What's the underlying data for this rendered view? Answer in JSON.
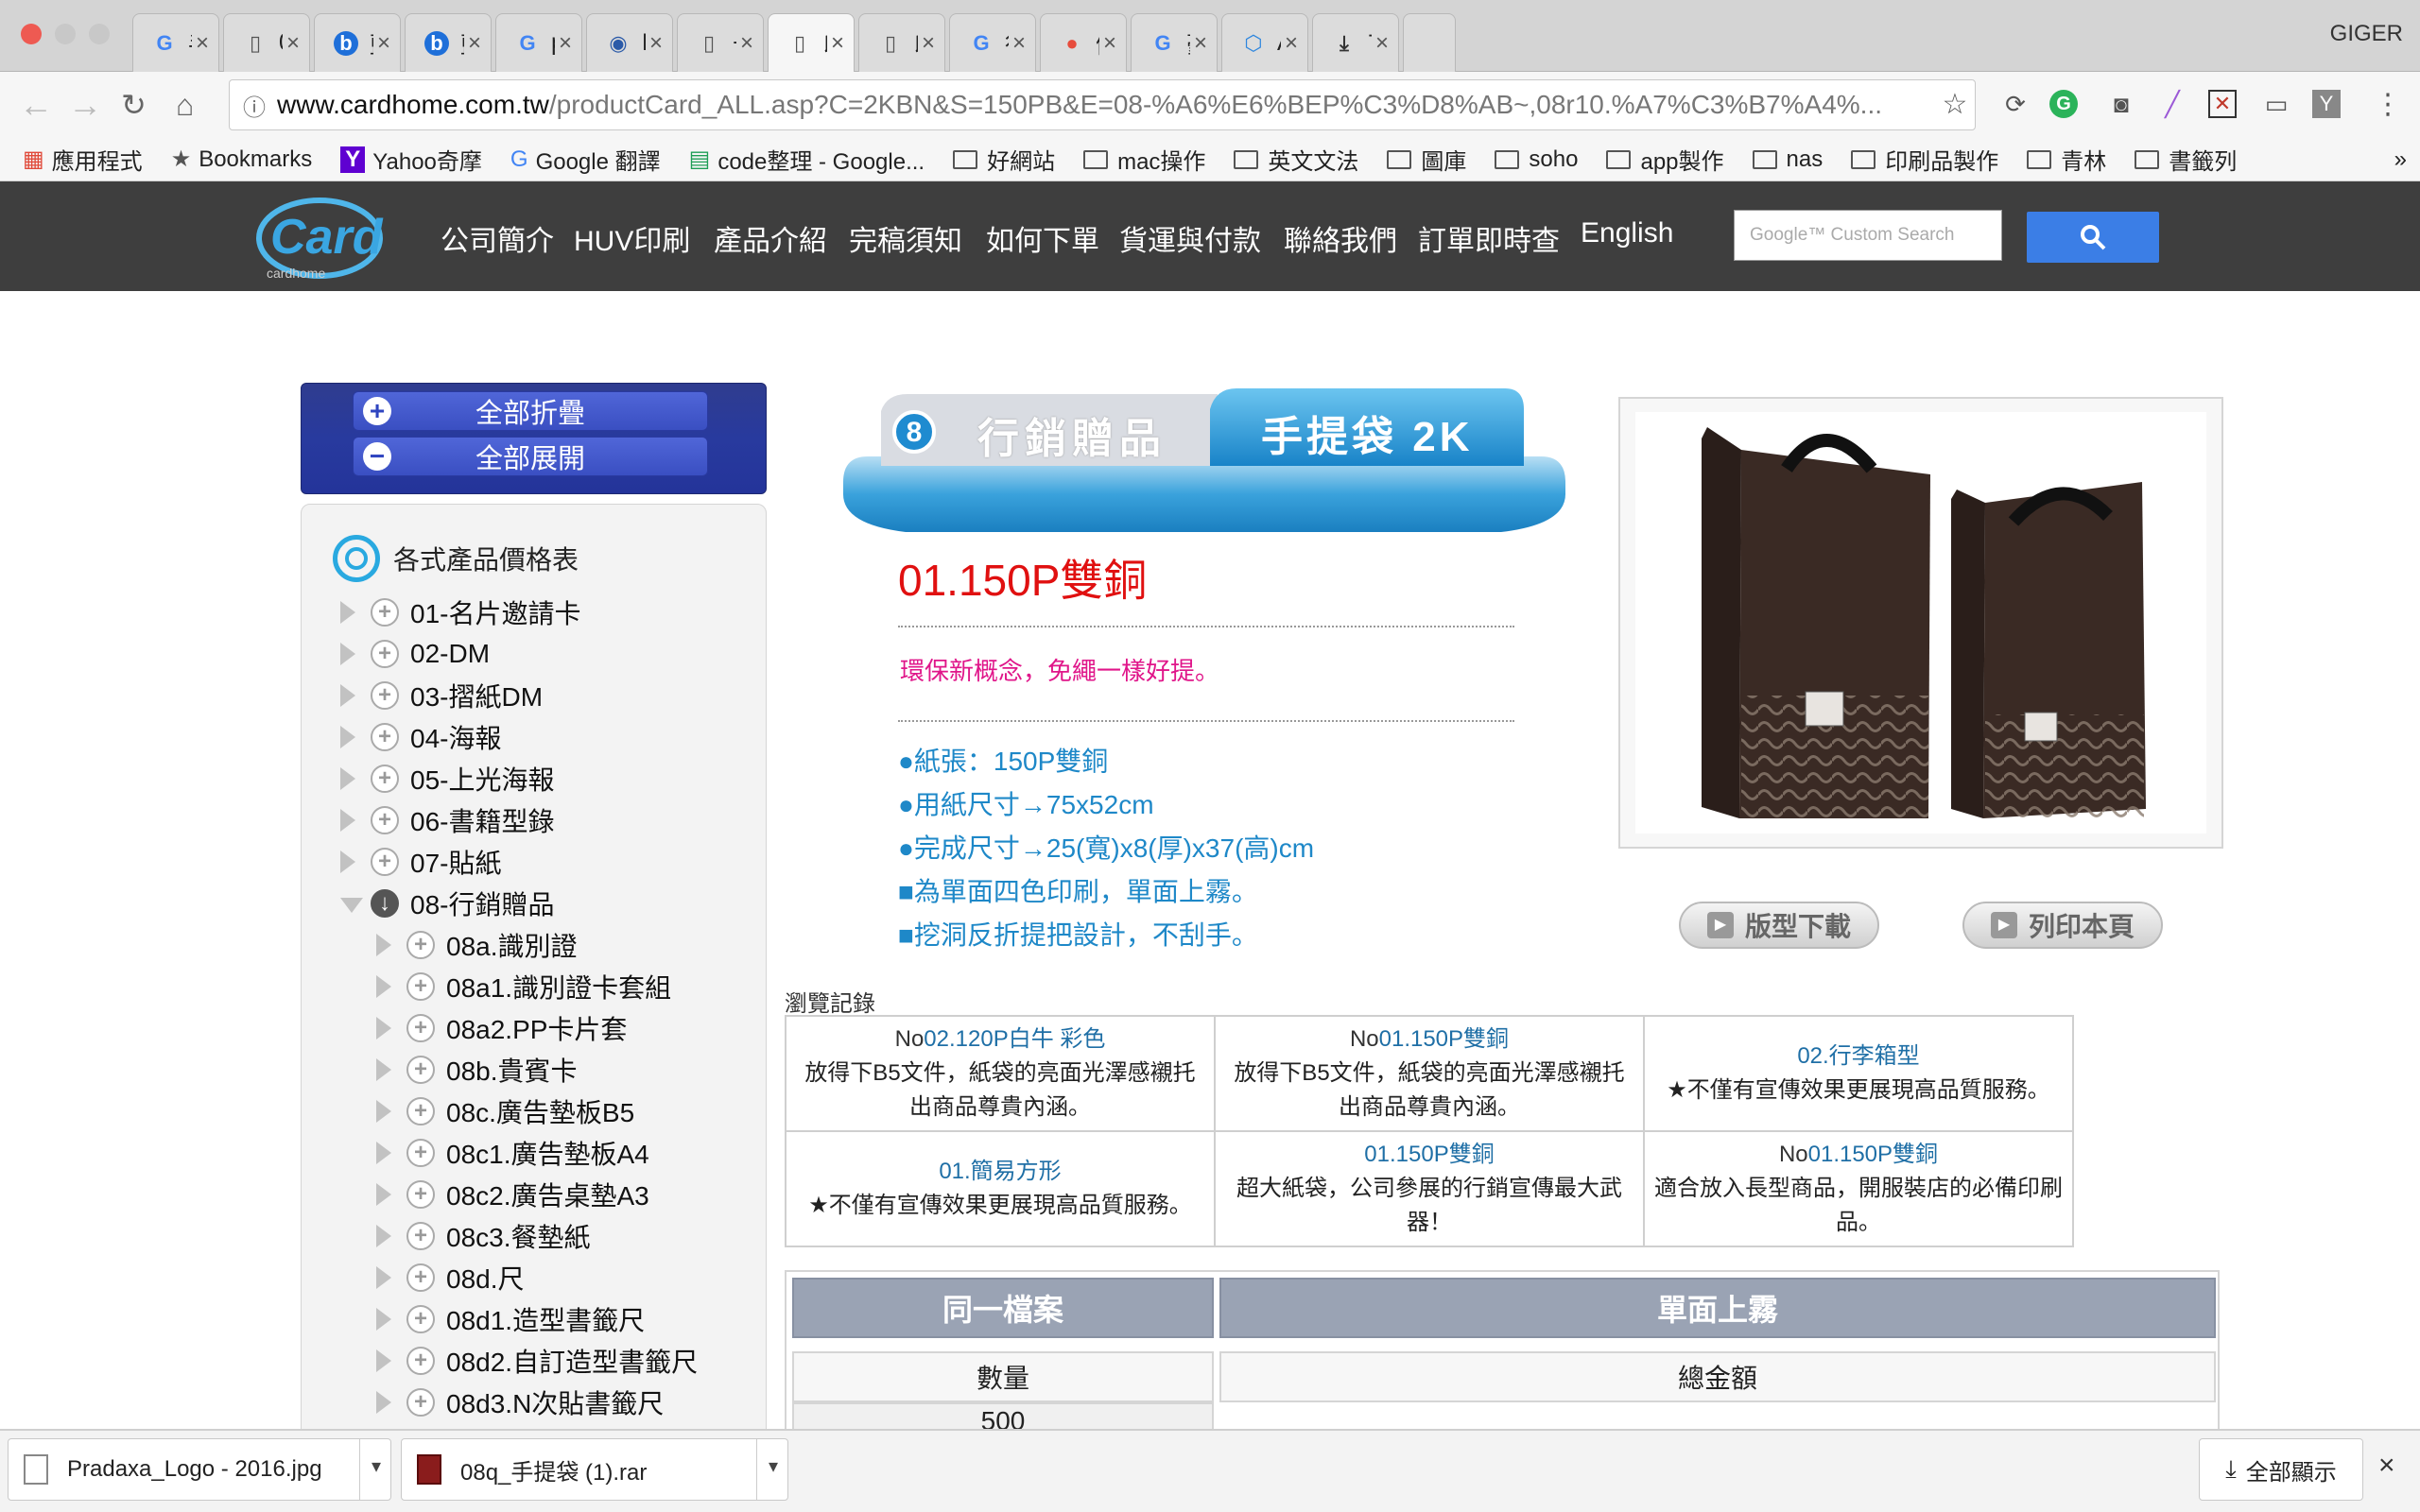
{
  "browser": {
    "profile": "GIGER",
    "tabs": [
      {
        "label": "手提",
        "icon": "G"
      },
      {
        "label": "033",
        "icon": "doc"
      },
      {
        "label": "藍格",
        "icon": "b"
      },
      {
        "label": "藍格",
        "icon": "b"
      },
      {
        "label": "prad",
        "icon": "G"
      },
      {
        "label": "Prad",
        "icon": "globe"
      },
      {
        "label": "卡之",
        "icon": "doc"
      },
      {
        "label": "印刷",
        "icon": "doc"
      },
      {
        "label": "印刷",
        "icon": "doc"
      },
      {
        "label": "行李",
        "icon": "G"
      },
      {
        "label": "健豪",
        "icon": "ball"
      },
      {
        "label": "豪堤",
        "icon": "G"
      },
      {
        "label": "Angu",
        "icon": "ng"
      },
      {
        "label": "下載",
        "icon": "download"
      }
    ],
    "active_tab_index": 7,
    "url_host": "www.cardhome.com.tw",
    "url_path": "/productCard_ALL.asp?C=2KBN&S=150PB&E=08-%A6%E6%BEP%C3%D8%AB~,08r10.%A7%C3%B7%A4%...",
    "bookmarks": [
      {
        "label": "應用程式",
        "icon": "apps-grid"
      },
      {
        "label": "Bookmarks",
        "icon": "star"
      },
      {
        "label": "Yahoo奇摩",
        "icon": "yahoo"
      },
      {
        "label": "Google 翻譯",
        "icon": "translate"
      },
      {
        "label": "code整理 - Google...",
        "icon": "sheets"
      },
      {
        "label": "好網站",
        "icon": "folder"
      },
      {
        "label": "mac操作",
        "icon": "folder"
      },
      {
        "label": "英文文法",
        "icon": "folder"
      },
      {
        "label": "圖庫",
        "icon": "folder"
      },
      {
        "label": "soho",
        "icon": "folder"
      },
      {
        "label": "app製作",
        "icon": "folder"
      },
      {
        "label": "nas",
        "icon": "folder"
      },
      {
        "label": "印刷品製作",
        "icon": "folder"
      },
      {
        "label": "青林",
        "icon": "folder"
      },
      {
        "label": "書籤列",
        "icon": "folder"
      }
    ],
    "more": "»"
  },
  "site": {
    "logo_text": "Card",
    "logo_sub": "cardhome",
    "nav": [
      "公司簡介",
      "HUV印刷",
      "產品介紹",
      "完稿須知",
      "如何下單",
      "貨運與付款",
      "聯絡我們",
      "訂單即時查",
      "English"
    ],
    "search_placeholder": "Google™ Custom Search"
  },
  "sidebar": {
    "collapse_all": "全部折疊",
    "expand_all": "全部展開",
    "title": "各式產品價格表",
    "items": [
      {
        "label": "01-名片邀請卡",
        "level": 0
      },
      {
        "label": "02-DM",
        "level": 0
      },
      {
        "label": "03-摺紙DM",
        "level": 0
      },
      {
        "label": "04-海報",
        "level": 0
      },
      {
        "label": "05-上光海報",
        "level": 0
      },
      {
        "label": "06-書籍型錄",
        "level": 0
      },
      {
        "label": "07-貼紙",
        "level": 0
      },
      {
        "label": "08-行銷贈品",
        "level": 0,
        "expanded": true
      },
      {
        "label": "08a.識別證",
        "level": 1
      },
      {
        "label": "08a1.識別證卡套組",
        "level": 1
      },
      {
        "label": "08a2.PP卡片套",
        "level": 1
      },
      {
        "label": "08b.貴賓卡",
        "level": 1
      },
      {
        "label": "08c.廣告墊板B5",
        "level": 1
      },
      {
        "label": "08c1.廣告墊板A4",
        "level": 1
      },
      {
        "label": "08c2.廣告桌墊A3",
        "level": 1
      },
      {
        "label": "08c3.餐墊紙",
        "level": 1
      },
      {
        "label": "08d.尺",
        "level": 1
      },
      {
        "label": "08d1.造型書籤尺",
        "level": 1
      },
      {
        "label": "08d2.自訂造型書籤尺",
        "level": 1
      },
      {
        "label": "08d3.N次貼書籤尺",
        "level": 1
      }
    ]
  },
  "product": {
    "category_number": "8",
    "category": "行銷贈品",
    "subcategory": "手提袋 2K",
    "title": "01.150P雙銅",
    "slogan": "環保新概念，免繩一樣好提。",
    "specs": [
      "●紙張：150P雙銅",
      "●用紙尺寸→75x52cm",
      "●完成尺寸→25(寬)x8(厚)x37(高)cm",
      "■為單面四色印刷，單面上霧。",
      "■挖洞反折提把設計，不刮手。"
    ],
    "download_template": "版型下載",
    "print_page": "列印本頁"
  },
  "history": {
    "label": "瀏覽記錄",
    "rows": [
      [
        {
          "prefix": "No",
          "name": "02.120P白牛 彩色",
          "desc": "放得下B5文件，紙袋的亮面光澤感襯托出商品尊貴內涵。"
        },
        {
          "prefix": "No",
          "name": "01.150P雙銅",
          "desc": "放得下B5文件，紙袋的亮面光澤感襯托出商品尊貴內涵。"
        },
        {
          "prefix": "",
          "name": "02.行李箱型",
          "desc": "★不僅有宣傳效果更展現高品質服務。"
        }
      ],
      [
        {
          "prefix": "",
          "name": "01.簡易方形",
          "desc": "★不僅有宣傳效果更展現高品質服務。"
        },
        {
          "prefix": "",
          "name": "01.150P雙銅",
          "desc": "超大紙袋，公司參展的行銷宣傳最大武器！"
        },
        {
          "prefix": "No",
          "name": "01.150P雙銅",
          "desc": "適合放入長型商品，開服裝店的必備印刷品。"
        }
      ]
    ]
  },
  "price": {
    "col1_header": "同一檔案",
    "col2_header": "單面上霧",
    "qty_label": "數量",
    "total_label": "總金額",
    "first_qty": "500"
  },
  "downloads": {
    "items": [
      {
        "name": "Pradaxa_Logo - 2016.jpg"
      },
      {
        "name": "08q_手提袋 (1).rar"
      }
    ],
    "show_all": "全部顯示",
    "close": "×"
  },
  "colors": {
    "header_bg": "#3e3e3e",
    "title_red": "#e01010",
    "slogan_pink": "#e0168a",
    "spec_blue": "#1e88c8",
    "sidebar_blue": "#283a9e",
    "search_btn": "#3b7ee6"
  }
}
